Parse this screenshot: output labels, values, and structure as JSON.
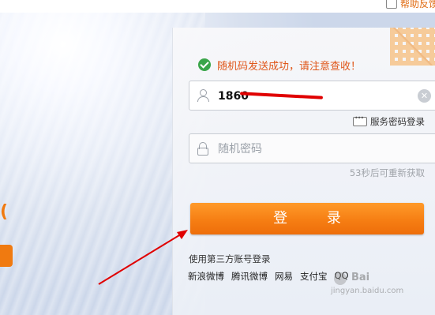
{
  "top_help": {
    "label": "帮助反馈"
  },
  "login": {
    "success_message": "随机码发送成功，请注意查收！",
    "phone_value": "1860",
    "password_placeholder": "随机密码",
    "service_login_label": "服务密码登录",
    "countdown_text": "53秒后可重新获取",
    "login_button_label": "登 录",
    "third_party_title": "使用第三方账号登录",
    "third_party_links": [
      "新浪微博",
      "腾讯微博",
      "网易",
      "支付宝",
      "QQ"
    ]
  },
  "watermark": {
    "brand": "Bai",
    "site": "jingyan.baidu.com"
  },
  "colors": {
    "accent": "#f57c12",
    "success": "#3aa54a",
    "message": "#e0571a",
    "annotation": "#e00000"
  },
  "icons": {
    "success": "check-circle-icon",
    "user": "user-icon",
    "lock": "lock-icon",
    "clear": "clear-icon",
    "keyboard": "keyboard-icon"
  }
}
